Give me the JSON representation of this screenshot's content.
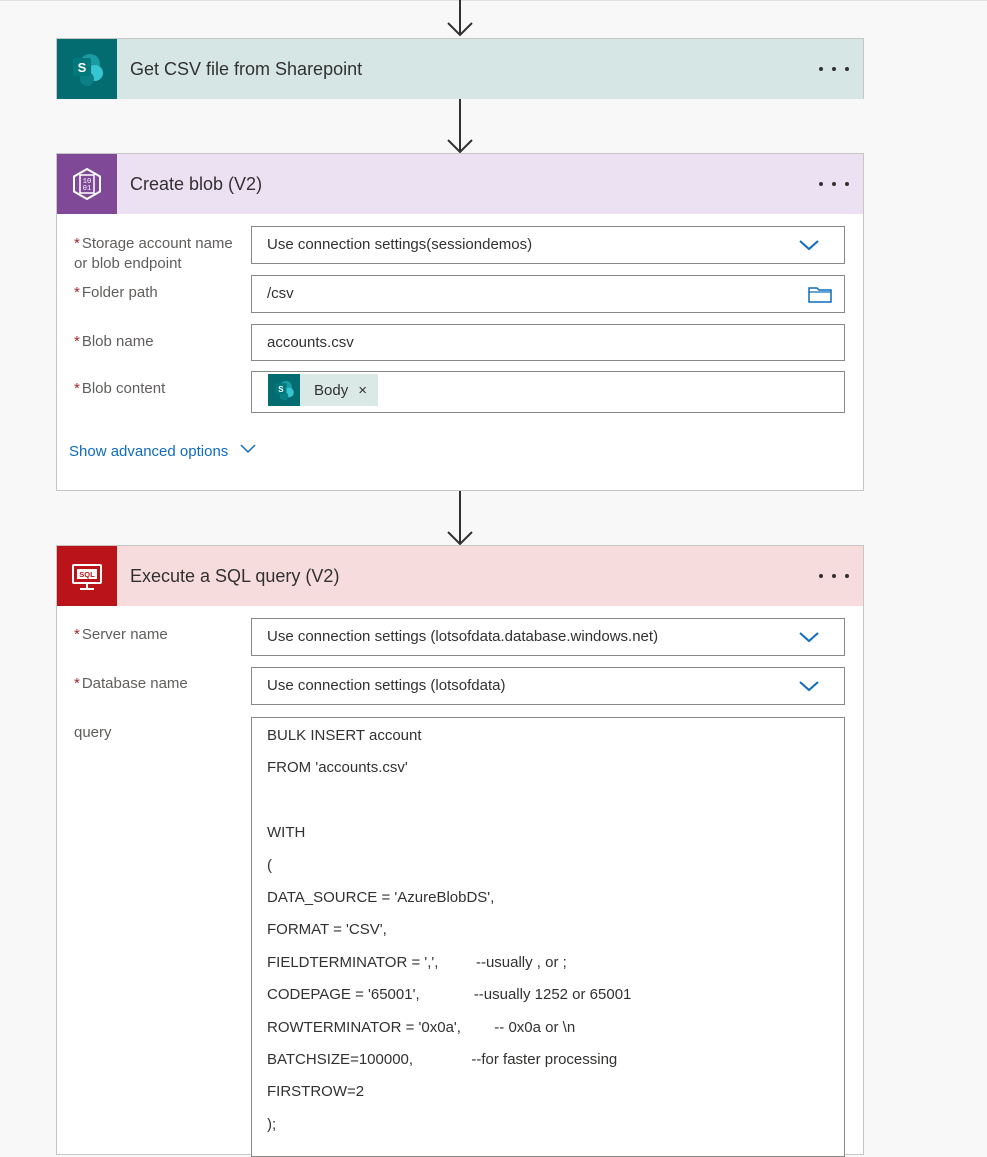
{
  "steps": [
    {
      "title": "Get CSV file from Sharepoint",
      "icon": "sharepoint-icon"
    },
    {
      "title": "Create blob (V2)",
      "icon": "blob-storage-icon"
    },
    {
      "title": "Execute a SQL query (V2)",
      "icon": "sql-icon"
    }
  ],
  "sharepoint_icon_letter": "S",
  "blob": {
    "storage_label_line1": "Storage account name",
    "storage_label_line2": "or blob endpoint",
    "storage_value": "Use connection settings(sessiondemos)",
    "folder_label": "Folder path",
    "folder_value": "/csv",
    "name_label": "Blob name",
    "name_value": "accounts.csv",
    "content_label": "Blob content",
    "content_token": "Body",
    "token_remove": "×",
    "advanced_link": "Show advanced options",
    "blob_icon_text_top": "10",
    "blob_icon_text_bottom": "01"
  },
  "sql": {
    "icon_text": "SQL",
    "server_label": "Server name",
    "server_value": "Use connection settings (lotsofdata.database.windows.net)",
    "database_label": "Database name",
    "database_value": "Use connection settings (lotsofdata)",
    "query_label": "query",
    "query_lines": [
      "BULK INSERT account",
      "FROM 'accounts.csv'",
      "",
      "WITH",
      "(",
      "DATA_SOURCE = 'AzureBlobDS',",
      "FORMAT = 'CSV',",
      "FIELDTERMINATOR = ',',         --usually , or ;",
      "CODEPAGE = '65001',             --usually 1252 or 65001",
      "ROWTERMINATOR = '0x0a',        -- 0x0a or \\n",
      "BATCHSIZE=100000,              --for faster processing",
      "FIRSTROW=2",
      ");"
    ]
  },
  "required_marker": "*",
  "colors": {
    "sharepoint_header": "#d6e6e4",
    "sharepoint_icon": "#036c70",
    "blob_header": "#ebe1f3",
    "blob_icon": "#804998",
    "sql_header": "#f6dcdd",
    "sql_icon": "#ba141a",
    "link": "#0f6cbd"
  }
}
